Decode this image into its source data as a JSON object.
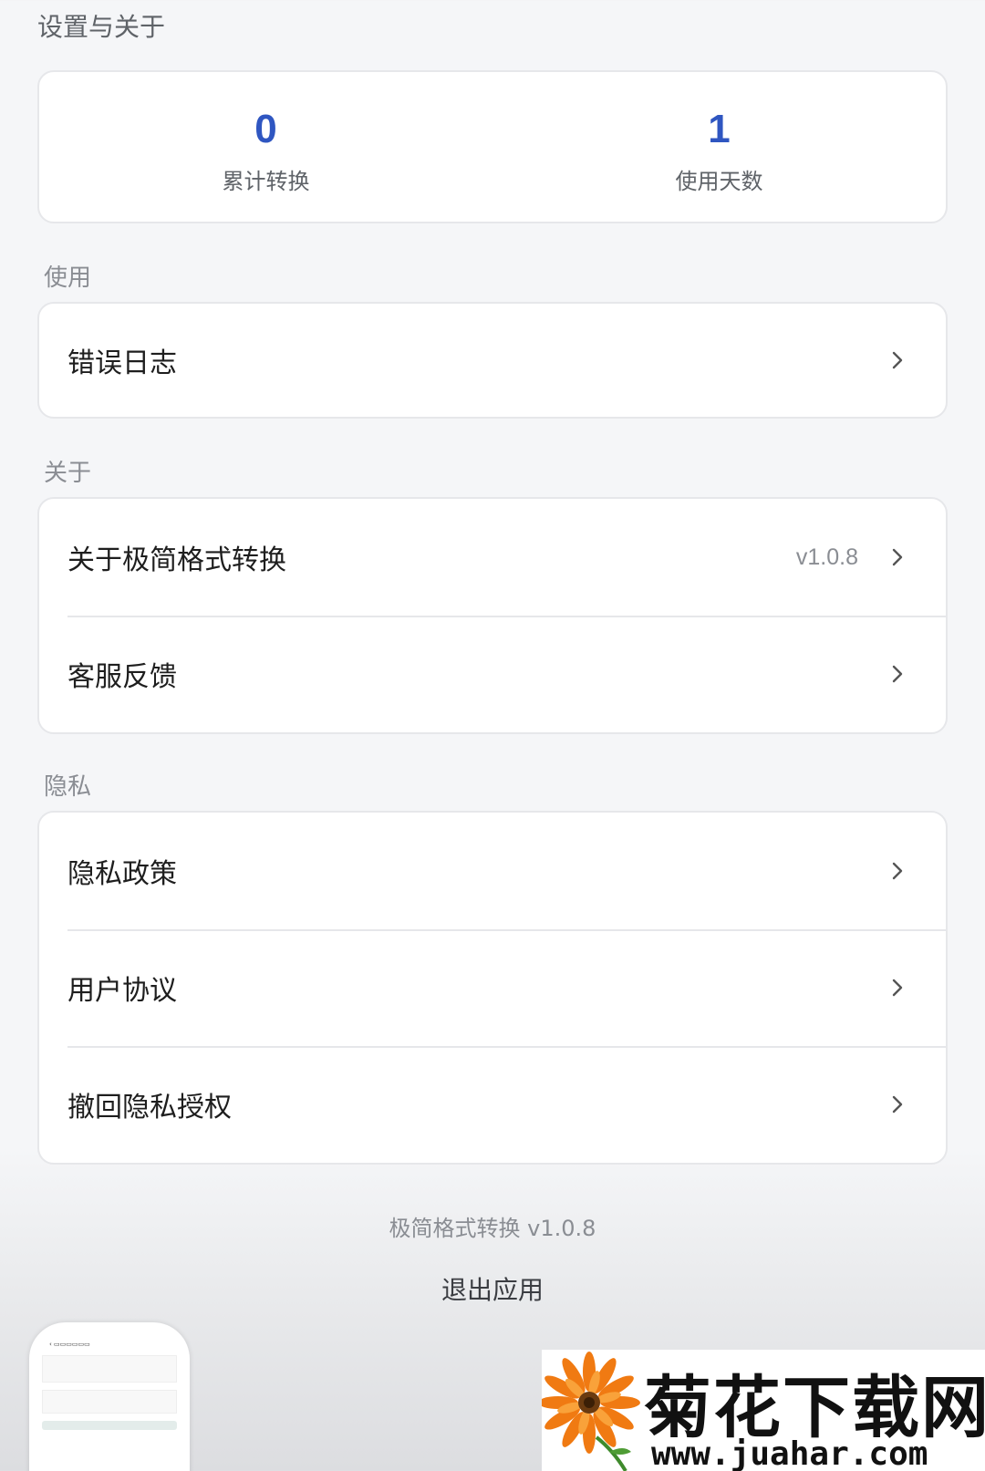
{
  "header": {
    "title": "设置与关于"
  },
  "stats": [
    {
      "value": "0",
      "label": "累计转换"
    },
    {
      "value": "1",
      "label": "使用天数"
    }
  ],
  "sections": {
    "usage": {
      "label": "使用",
      "items": [
        {
          "label": "错误日志"
        }
      ]
    },
    "about": {
      "label": "关于",
      "items": [
        {
          "label": "关于极简格式转换",
          "value": "v1.0.8"
        },
        {
          "label": "客服反馈"
        }
      ]
    },
    "privacy": {
      "label": "隐私",
      "items": [
        {
          "label": "隐私政策"
        },
        {
          "label": "用户协议"
        },
        {
          "label": "撤回隐私授权"
        }
      ]
    }
  },
  "footer": {
    "version_text": "极简格式转换 v1.0.8",
    "exit_label": "退出应用"
  },
  "watermark": {
    "name": "菊花下载网",
    "url": "www.juahar.com"
  },
  "icons": {
    "chevron": "chevron-right-icon",
    "flower": "flower-icon"
  },
  "colors": {
    "accent": "#2f56c1",
    "background": "#f5f6f8",
    "card": "#ffffff",
    "secondary_text": "#8a8d93"
  }
}
